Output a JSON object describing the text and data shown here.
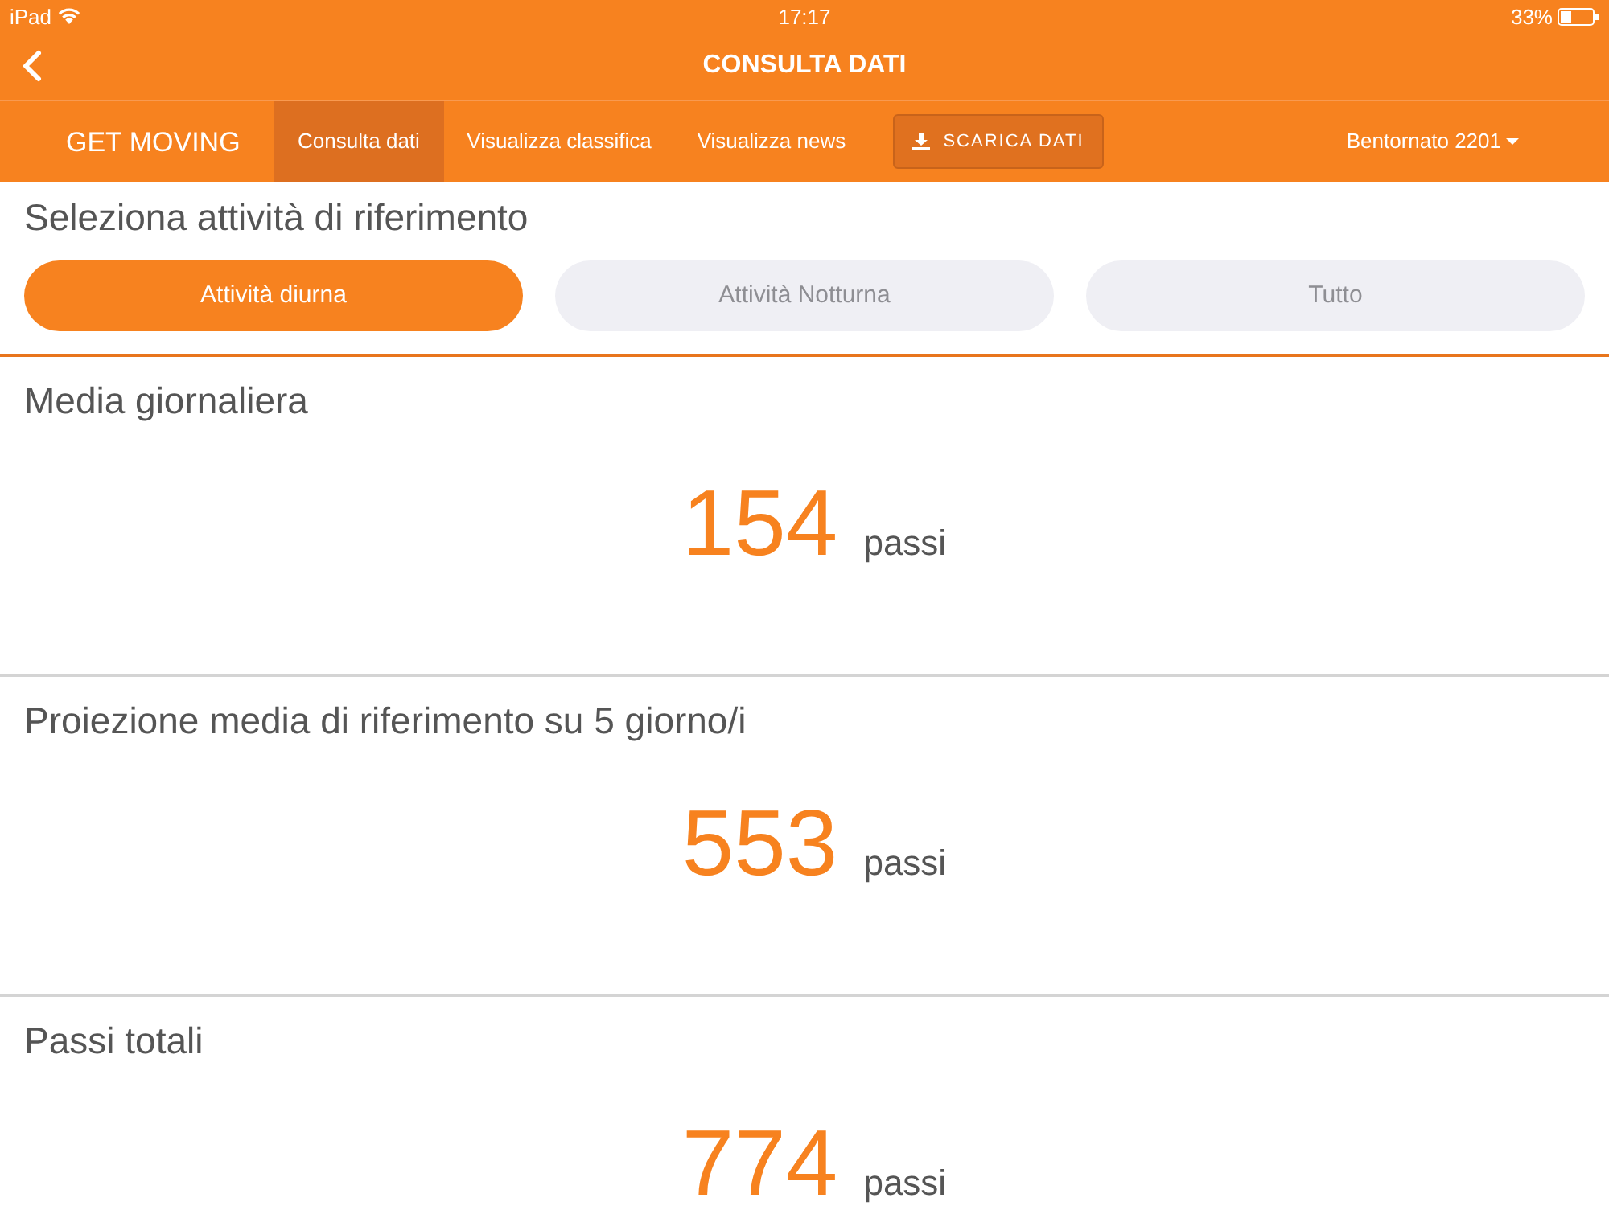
{
  "status_bar": {
    "device": "iPad",
    "time": "17:17",
    "battery": "33%"
  },
  "title_bar": {
    "title": "CONSULTA DATI"
  },
  "nav": {
    "brand": "GET MOVING",
    "tabs": [
      {
        "label": "Consulta dati",
        "selected": true
      },
      {
        "label": "Visualizza classifica",
        "selected": false
      },
      {
        "label": "Visualizza news",
        "selected": false
      }
    ],
    "download_button": "SCARICA DATI",
    "user_menu": "Bentornato 2201"
  },
  "activity_selector": {
    "title": "Seleziona attività di riferimento",
    "options": [
      {
        "label": "Attività diurna",
        "selected": true
      },
      {
        "label": "Attività Notturna",
        "selected": false
      },
      {
        "label": "Tutto",
        "selected": false
      }
    ]
  },
  "sections": [
    {
      "title": "Media giornaliera",
      "value": "154",
      "unit": "passi"
    },
    {
      "title": "Proiezione media di riferimento su 5 giorno/i",
      "value": "553",
      "unit": "passi"
    },
    {
      "title": "Passi totali",
      "value": "774",
      "unit": "passi"
    }
  ]
}
